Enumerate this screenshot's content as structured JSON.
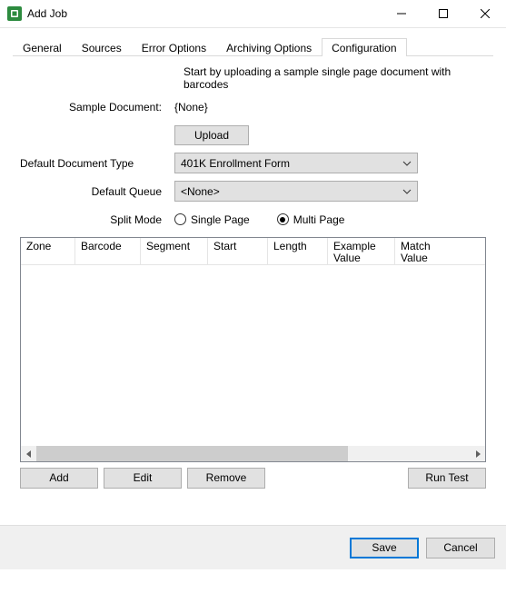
{
  "window": {
    "title": "Add Job"
  },
  "tabs": {
    "items": [
      {
        "label": "General"
      },
      {
        "label": "Sources"
      },
      {
        "label": "Error Options"
      },
      {
        "label": "Archiving Options"
      },
      {
        "label": "Configuration"
      }
    ],
    "activeIndex": 4
  },
  "config": {
    "hint": "Start by uploading a sample single page document with barcodes",
    "sampleDocLabel": "Sample Document:",
    "sampleDocValue": "{None}",
    "uploadLabel": "Upload",
    "docTypeLabel": "Default Document Type",
    "docTypeValue": "401K Enrollment Form",
    "queueLabel": "Default Queue",
    "queueValue": "<None>",
    "splitLabel": "Split Mode",
    "splitSingle": "Single Page",
    "splitMulti": "Multi Page",
    "splitSelected": "multi"
  },
  "table": {
    "headers": [
      "Zone",
      "Barcode",
      "Segment",
      "Start",
      "Length",
      "Example Value",
      "Match Value"
    ],
    "rows": []
  },
  "actions": {
    "add": "Add",
    "edit": "Edit",
    "remove": "Remove",
    "runTest": "Run Test"
  },
  "footer": {
    "save": "Save",
    "cancel": "Cancel"
  }
}
